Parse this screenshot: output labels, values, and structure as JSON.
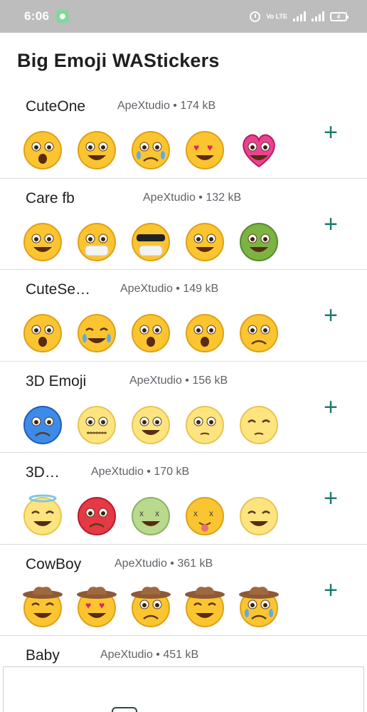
{
  "status_bar": {
    "time": "6:06",
    "volte_label": "Vo LTE",
    "battery_level": "4"
  },
  "header": {
    "title": "Big Emoji WAStickers"
  },
  "packs": [
    {
      "name": "CuteOne",
      "meta": "ApeXtudio • 174 kB",
      "stickers": [
        "shocked-face",
        "grinning-face",
        "crying-face",
        "heart-eyes-face",
        "heart-face"
      ]
    },
    {
      "name": "Care fb",
      "meta": "ApeXtudio • 132 kB",
      "stickers": [
        "care-hug-face",
        "thumbs-up-mask-face",
        "sunglasses-mask-face",
        "kissing-face",
        "money-face"
      ]
    },
    {
      "name": "CuteSe…",
      "meta": "ApeXtudio • 149 kB",
      "stickers": [
        "anxious-face",
        "tears-of-joy-face",
        "screaming-face",
        "scared-hands-face",
        "pleading-face"
      ]
    },
    {
      "name": "3D Emoji",
      "meta": "ApeXtudio • 156 kB",
      "stickers": [
        "blue-frown-face",
        "zipper-face",
        "grimacing-face",
        "thermometer-face",
        "sleeping-face"
      ]
    },
    {
      "name": "3D…",
      "meta": "ApeXtudio • 170 kB",
      "stickers": [
        "halo-face",
        "angry-red-face",
        "nauseated-face",
        "dizzy-tongue-face",
        "squinting-face"
      ]
    },
    {
      "name": "CowBoy",
      "meta": "ApeXtudio • 361 kB",
      "stickers": [
        "cowboy-smile-face",
        "cowboy-heart-eyes-face",
        "cowboy-angry-face",
        "cowboy-laughing-face",
        "cowboy-crying-face"
      ]
    }
  ],
  "partial_pack": {
    "name": "Baby",
    "meta": "ApeXtudio • 451 kB"
  },
  "add_icon_glyph": "+",
  "colors": {
    "accent": "#1f7a6e",
    "status_bar": "#bdbdbd",
    "emoji_yellow": "#fbc531"
  }
}
